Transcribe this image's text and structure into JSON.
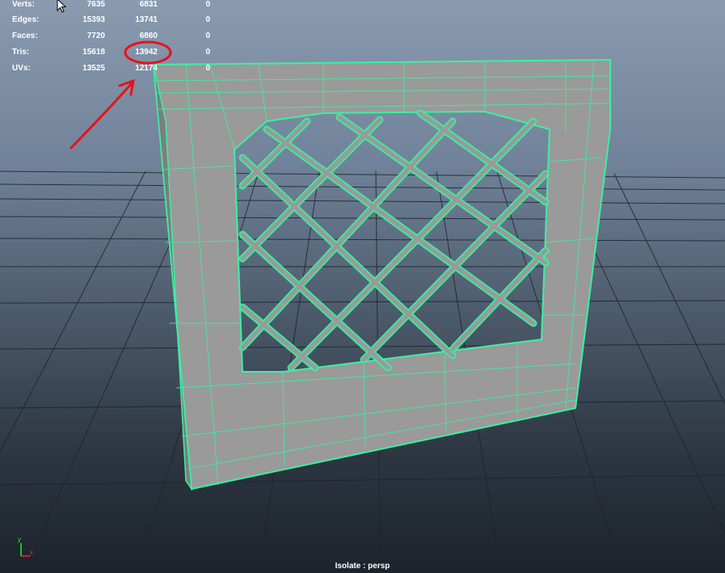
{
  "hud": {
    "rows": [
      {
        "label": "Verts:",
        "v1": "7635",
        "v2": "6831",
        "v3": "0"
      },
      {
        "label": "Edges:",
        "v1": "15393",
        "v2": "13741",
        "v3": "0"
      },
      {
        "label": "Faces:",
        "v1": "7720",
        "v2": "6860",
        "v3": "0"
      },
      {
        "label": "Tris:",
        "v1": "15618",
        "v2": "13942",
        "v3": "0"
      },
      {
        "label": "UVs:",
        "v1": "13525",
        "v2": "12174",
        "v3": "0"
      }
    ]
  },
  "viewport": {
    "isolate_label": "Isolate : persp",
    "wire_color": "#3cf0a0",
    "mesh_color": "#9a9a9a",
    "annotation_color": "#e8111a"
  },
  "axis": {
    "y": "y",
    "x": "x"
  }
}
